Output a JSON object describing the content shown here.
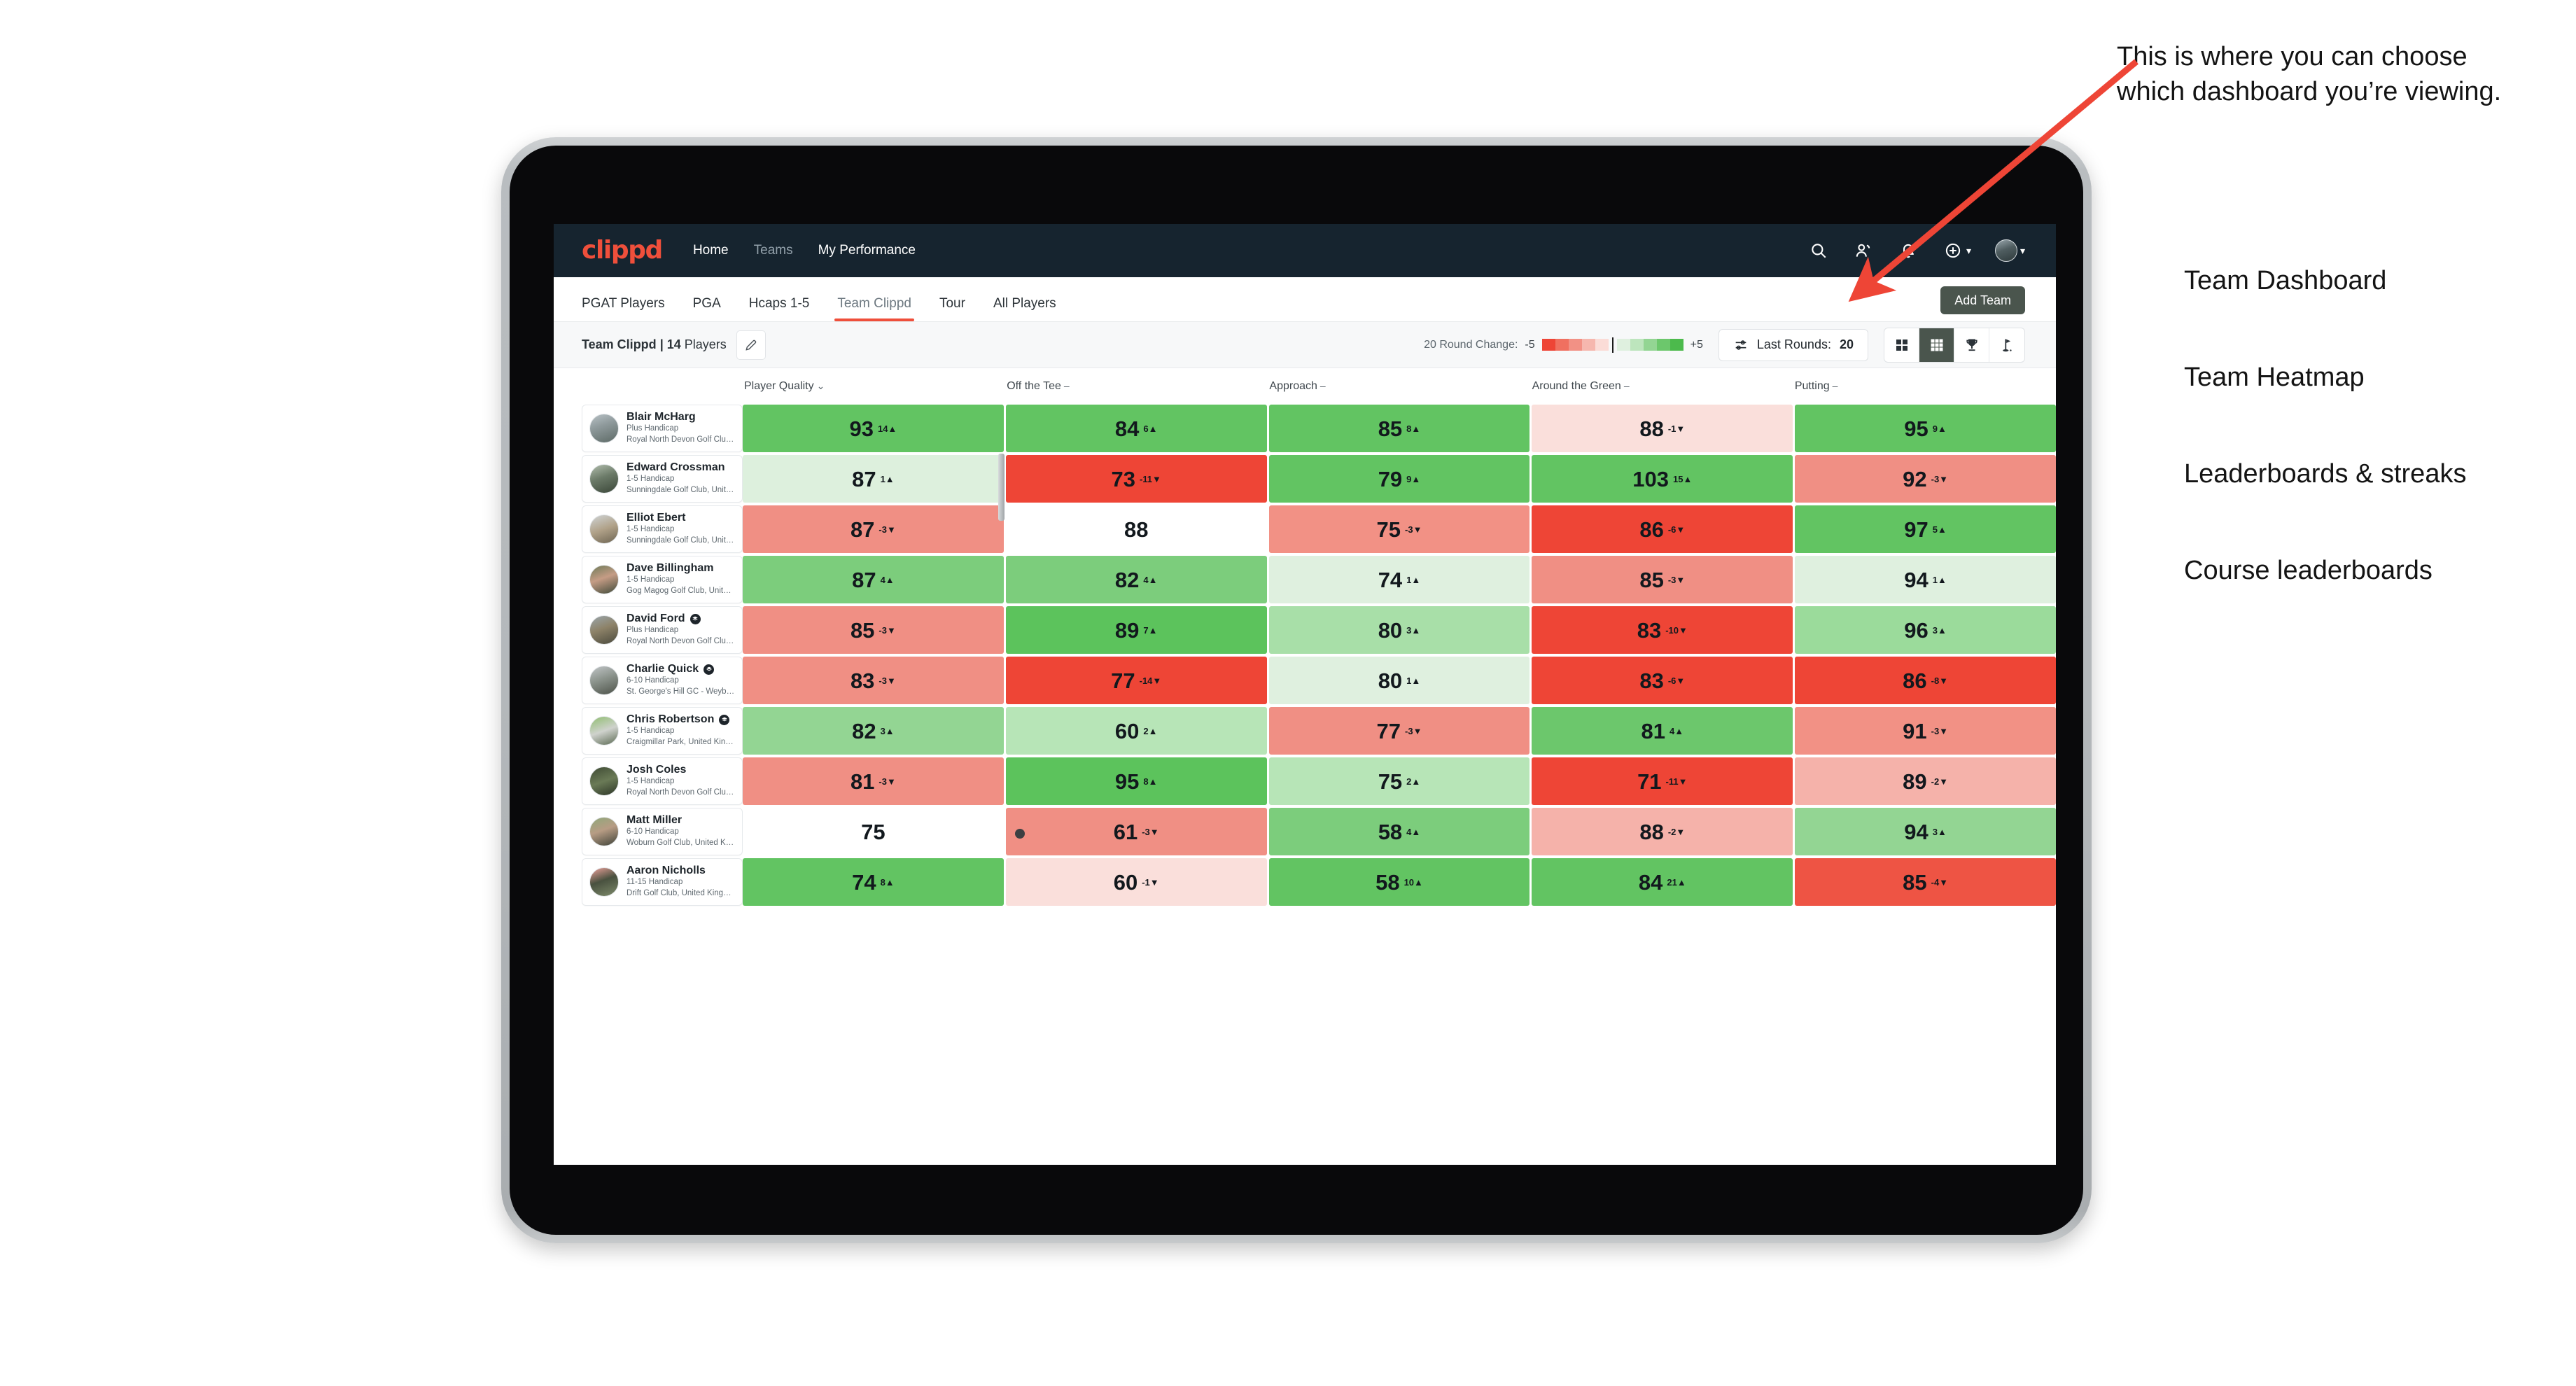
{
  "app": {
    "brand": "clippd",
    "topnav": [
      {
        "label": "Home",
        "muted": false
      },
      {
        "label": "Teams",
        "muted": true
      },
      {
        "label": "My Performance",
        "muted": false
      }
    ],
    "topnav_icons": [
      "search-icon",
      "people-icon",
      "bell-icon",
      "plus-circle-icon",
      "avatar"
    ],
    "tabs": [
      {
        "label": "PGAT Players",
        "active": false,
        "muted": false
      },
      {
        "label": "PGA",
        "active": false,
        "muted": false
      },
      {
        "label": "Hcaps 1-5",
        "active": false,
        "muted": false
      },
      {
        "label": "Team Clippd",
        "active": true,
        "muted": true
      },
      {
        "label": "Tour",
        "active": false,
        "muted": false
      },
      {
        "label": "All Players",
        "active": false,
        "muted": false
      }
    ],
    "add_team_label": "Add Team"
  },
  "subbar": {
    "team_name": "Team Clippd",
    "team_separator": " | ",
    "team_count": "14",
    "team_count_suffix": " Players",
    "edit_icon": "pencil-icon",
    "legend_title": "20 Round Change:",
    "legend_min": "-5",
    "legend_max": "+5",
    "legend_colors": [
      "#ee4536",
      "#f07060",
      "#f29185",
      "#f6b7ae",
      "#fbdcd7",
      "#dff0df",
      "#bde5bd",
      "#93d593",
      "#6cc76c",
      "#4cba4c"
    ],
    "rounds_filter_label": "Last Rounds:",
    "rounds_filter_value": "20",
    "view_buttons": [
      {
        "name": "grid-2x2-icon",
        "title": "Team Dashboard",
        "active": false
      },
      {
        "name": "grid-3x3-icon",
        "title": "Team Heatmap",
        "active": true
      },
      {
        "name": "trophy-icon",
        "title": "Leaderboards & streaks",
        "active": false
      },
      {
        "name": "flag-icon",
        "title": "Course leaderboards",
        "active": false
      }
    ]
  },
  "chart_data": {
    "type": "heatmap",
    "title": "Team Clippd — Team Heatmap",
    "columns": [
      {
        "label": "Player Quality",
        "sym": "chevron-down-icon"
      },
      {
        "label": "Off the Tee",
        "sym": "dash-icon"
      },
      {
        "label": "Approach",
        "sym": "dash-icon"
      },
      {
        "label": "Around the Green",
        "sym": "dash-icon"
      },
      {
        "label": "Putting",
        "sym": "dash-icon"
      }
    ],
    "legend": {
      "min": -5,
      "max": 5,
      "position": "top-right",
      "label": "20 Round Change"
    },
    "rows": [
      {
        "name": "Blair McHarg",
        "verified": false,
        "handicap": "Plus Handicap",
        "club": "Royal North Devon Golf Club, United Kingdom",
        "avatar": "linear-gradient(160deg,#b9c2c6 0%,#8f9a9c 40%,#5d6a66 100%)",
        "cells": [
          {
            "value": "93",
            "delta": "14",
            "dir": "up",
            "bg": "#62c462"
          },
          {
            "value": "84",
            "delta": "6",
            "dir": "up",
            "bg": "#62c462"
          },
          {
            "value": "85",
            "delta": "8",
            "dir": "up",
            "bg": "#62c462"
          },
          {
            "value": "88",
            "delta": "-1",
            "dir": "down",
            "bg": "#fadfdb"
          },
          {
            "value": "95",
            "delta": "9",
            "dir": "up",
            "bg": "#62c462"
          }
        ]
      },
      {
        "name": "Edward Crossman",
        "verified": false,
        "handicap": "1-5 Handicap",
        "club": "Sunningdale Golf Club, United Kingdom",
        "avatar": "linear-gradient(160deg,#b3bfae 0%,#6b7a68 45%,#3a4638 100%)",
        "cells": [
          {
            "value": "87",
            "delta": "1",
            "dir": "up",
            "bg": "#ddf0dd"
          },
          {
            "value": "73",
            "delta": "-11",
            "dir": "down",
            "bg": "#ee4536"
          },
          {
            "value": "79",
            "delta": "9",
            "dir": "up",
            "bg": "#62c462"
          },
          {
            "value": "103",
            "delta": "15",
            "dir": "up",
            "bg": "#62c462"
          },
          {
            "value": "92",
            "delta": "-3",
            "dir": "down",
            "bg": "#f08f84"
          }
        ]
      },
      {
        "name": "Elliot Ebert",
        "verified": false,
        "handicap": "1-5 Handicap",
        "club": "Sunningdale Golf Club, United Kingdom",
        "avatar": "linear-gradient(160deg,#cfd4d6 0%,#b0a188 50%,#6d6452 100%)",
        "cells": [
          {
            "value": "87",
            "delta": "-3",
            "dir": "down",
            "bg": "#f08f84"
          },
          {
            "value": "88",
            "delta": "",
            "dir": "",
            "bg": "#ffffff"
          },
          {
            "value": "75",
            "delta": "-3",
            "dir": "down",
            "bg": "#f29185"
          },
          {
            "value": "86",
            "delta": "-6",
            "dir": "down",
            "bg": "#ee4536"
          },
          {
            "value": "97",
            "delta": "5",
            "dir": "up",
            "bg": "#62c462"
          }
        ]
      },
      {
        "name": "Dave Billingham",
        "verified": false,
        "handicap": "1-5 Handicap",
        "club": "Gog Magog Golf Club, United Kingdom",
        "avatar": "linear-gradient(160deg,#6d7a58 0%,#c59c85 45%,#3f4a39 100%)",
        "cells": [
          {
            "value": "87",
            "delta": "4",
            "dir": "up",
            "bg": "#7ccd7c"
          },
          {
            "value": "82",
            "delta": "4",
            "dir": "up",
            "bg": "#7ccd7c"
          },
          {
            "value": "74",
            "delta": "1",
            "dir": "up",
            "bg": "#dff0df"
          },
          {
            "value": "85",
            "delta": "-3",
            "dir": "down",
            "bg": "#f08f84"
          },
          {
            "value": "94",
            "delta": "1",
            "dir": "up",
            "bg": "#dff0df"
          }
        ]
      },
      {
        "name": "David Ford",
        "verified": true,
        "handicap": "Plus Handicap",
        "club": "Royal North Devon Golf Club, United Kingdom",
        "avatar": "linear-gradient(160deg,#9aa6ac 0%,#8d8268 45%,#4b4a3d 100%)",
        "cells": [
          {
            "value": "85",
            "delta": "-3",
            "dir": "down",
            "bg": "#f08f84"
          },
          {
            "value": "89",
            "delta": "7",
            "dir": "up",
            "bg": "#5cc35c"
          },
          {
            "value": "80",
            "delta": "3",
            "dir": "up",
            "bg": "#a8dfa8"
          },
          {
            "value": "83",
            "delta": "-10",
            "dir": "down",
            "bg": "#ee4536"
          },
          {
            "value": "96",
            "delta": "3",
            "dir": "up",
            "bg": "#9bdb9b"
          }
        ]
      },
      {
        "name": "Charlie Quick",
        "verified": true,
        "handicap": "6-10 Handicap",
        "club": "St. George's Hill GC - Weybridge - Surrey, Uni...",
        "avatar": "linear-gradient(160deg,#c2c6c8 0%,#8b938c 45%,#4d5249 100%)",
        "cells": [
          {
            "value": "83",
            "delta": "-3",
            "dir": "down",
            "bg": "#f08f84"
          },
          {
            "value": "77",
            "delta": "-14",
            "dir": "down",
            "bg": "#ee4536"
          },
          {
            "value": "80",
            "delta": "1",
            "dir": "up",
            "bg": "#dff0df"
          },
          {
            "value": "83",
            "delta": "-6",
            "dir": "down",
            "bg": "#ee4536"
          },
          {
            "value": "86",
            "delta": "-8",
            "dir": "down",
            "bg": "#ee4536"
          }
        ]
      },
      {
        "name": "Chris Robertson",
        "verified": true,
        "handicap": "1-5 Handicap",
        "club": "Craigmillar Park, United Kingdom",
        "avatar": "linear-gradient(160deg,#8fbd6f 0%,#cfd2cd 50%,#5b6a52 100%)",
        "cells": [
          {
            "value": "82",
            "delta": "3",
            "dir": "up",
            "bg": "#93d593"
          },
          {
            "value": "60",
            "delta": "2",
            "dir": "up",
            "bg": "#b7e5b7"
          },
          {
            "value": "77",
            "delta": "-3",
            "dir": "down",
            "bg": "#f08f84"
          },
          {
            "value": "81",
            "delta": "4",
            "dir": "up",
            "bg": "#6cc76c"
          },
          {
            "value": "91",
            "delta": "-3",
            "dir": "down",
            "bg": "#f29185"
          }
        ]
      },
      {
        "name": "Josh Coles",
        "verified": false,
        "handicap": "1-5 Handicap",
        "club": "Royal North Devon Golf Club, United Kingdom",
        "avatar": "linear-gradient(160deg,#3e4a33 0%,#6a7a56 50%,#2c3526 100%)",
        "cells": [
          {
            "value": "81",
            "delta": "-3",
            "dir": "down",
            "bg": "#f08f84"
          },
          {
            "value": "95",
            "delta": "8",
            "dir": "up",
            "bg": "#5cc35c"
          },
          {
            "value": "75",
            "delta": "2",
            "dir": "up",
            "bg": "#b7e5b7"
          },
          {
            "value": "71",
            "delta": "-11",
            "dir": "down",
            "bg": "#ee4536"
          },
          {
            "value": "89",
            "delta": "-2",
            "dir": "down",
            "bg": "#f5b2aa"
          }
        ]
      },
      {
        "name": "Matt Miller",
        "verified": false,
        "handicap": "6-10 Handicap",
        "club": "Woburn Golf Club, United Kingdom",
        "avatar": "linear-gradient(160deg,#8fa87a 0%,#b79c84 45%,#3e4238 100%)",
        "cells": [
          {
            "value": "75",
            "delta": "",
            "dir": "",
            "bg": "#ffffff"
          },
          {
            "value": "61",
            "delta": "-3",
            "dir": "down",
            "bg": "#f08f84"
          },
          {
            "value": "58",
            "delta": "4",
            "dir": "up",
            "bg": "#7ccd7c"
          },
          {
            "value": "88",
            "delta": "-2",
            "dir": "down",
            "bg": "#f5b2aa"
          },
          {
            "value": "94",
            "delta": "3",
            "dir": "up",
            "bg": "#93d593"
          }
        ]
      },
      {
        "name": "Aaron Nicholls",
        "verified": false,
        "handicap": "11-15 Handicap",
        "club": "Drift Golf Club, United Kingdom",
        "avatar": "linear-gradient(160deg,#f0a39c 0%,#49513f 45%,#7d8a6a 100%)",
        "cells": [
          {
            "value": "74",
            "delta": "8",
            "dir": "up",
            "bg": "#62c462"
          },
          {
            "value": "60",
            "delta": "-1",
            "dir": "down",
            "bg": "#fadfdb"
          },
          {
            "value": "58",
            "delta": "10",
            "dir": "up",
            "bg": "#62c462"
          },
          {
            "value": "84",
            "delta": "21",
            "dir": "up",
            "bg": "#62c462"
          },
          {
            "value": "85",
            "delta": "-4",
            "dir": "down",
            "bg": "#ee5444"
          }
        ]
      }
    ]
  },
  "annotations": {
    "callout": "This is where you can choose which dashboard you’re viewing.",
    "arrow_color": "#ee4536",
    "dashboard_list": [
      "Team Dashboard",
      "Team Heatmap",
      "Leaderboards & streaks",
      "Course leaderboards"
    ]
  }
}
